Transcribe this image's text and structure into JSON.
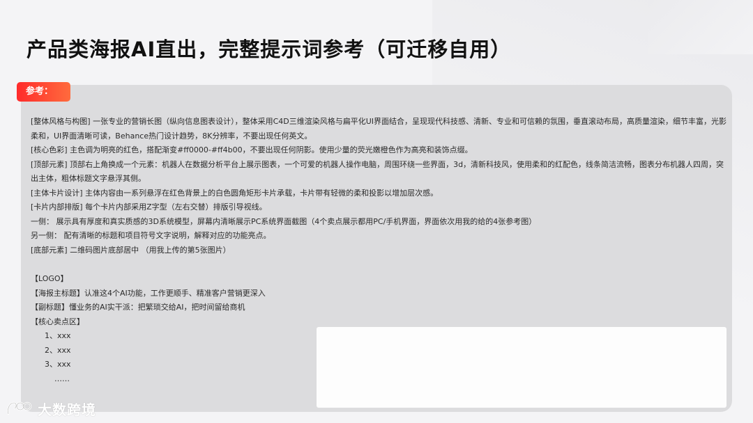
{
  "title": "产品类海报AI直出，完整提示词参考（可迁移自用）",
  "tag_label": "参考：",
  "paragraphs": [
    "[整体风格与构图] 一张专业的营销长图（纵向信息图表设计），整体采用C4D三维渲染风格与扁平化UI界面结合，呈现现代科技感、清新、专业和可信赖的氛围，垂直滚动布局，高质量渲染，细节丰富，光影柔和，UI界面清晰可读，Behance热门设计趋势，8K分辨率，不要出现任何英文。",
    "[核心色彩] 主色调为明亮的红色，搭配渐变#ff0000-#ff4b00，不要出现任何阴影。使用少量的荧光嫩橙色作为高亮和装饰点缀。",
    "[顶部元素] 顶部右上角换成一个元素：机器人在数据分析平台上展示图表，一个可爱的机器人操作电脑，周围环绕一些界面，3d，清新科技风，使用柔和的红配色，线条简洁流畅，图表分布机器人四周，突出主体，粗体标题文字悬浮其侧。",
    "[主体卡片设计] 主体内容由一系列悬浮在红色背景上的白色圆角矩形卡片承载，卡片带有轻微的柔和投影以增加层次感。",
    "[卡片内部排版] 每个卡片内部采用Z字型（左右交替）排版引导视线。",
    "一侧： 展示具有厚度和真实质感的3D系统模型，屏幕内清晰展示PC系统界面截图（4个卖点展示都用PC/手机界面，界面依次用我的给的4张参考图）",
    "另一侧： 配有清晰的标题和项目符号文字说明，解释对应的功能亮点。",
    "[底部元素] 二维码图片底部居中 （用我上传的第5张图片）"
  ],
  "sections": [
    "【LOGO】",
    "【海报主标题】认准这4个AI功能，工作更顺手、精准客户营销更深入",
    "【副标题】懂业务的AI实干派：把繁琐交给AI，把时间留给商机",
    "【核心卖点区】"
  ],
  "list_items": [
    "1、xxx",
    "2、xxx",
    "3、xxx"
  ],
  "ellipsis": "……",
  "brand": "大数跨境",
  "colors": {
    "accent_start": "#ff2b2b",
    "accent_end": "#ff6b3d",
    "panel": "#dcdcde"
  }
}
